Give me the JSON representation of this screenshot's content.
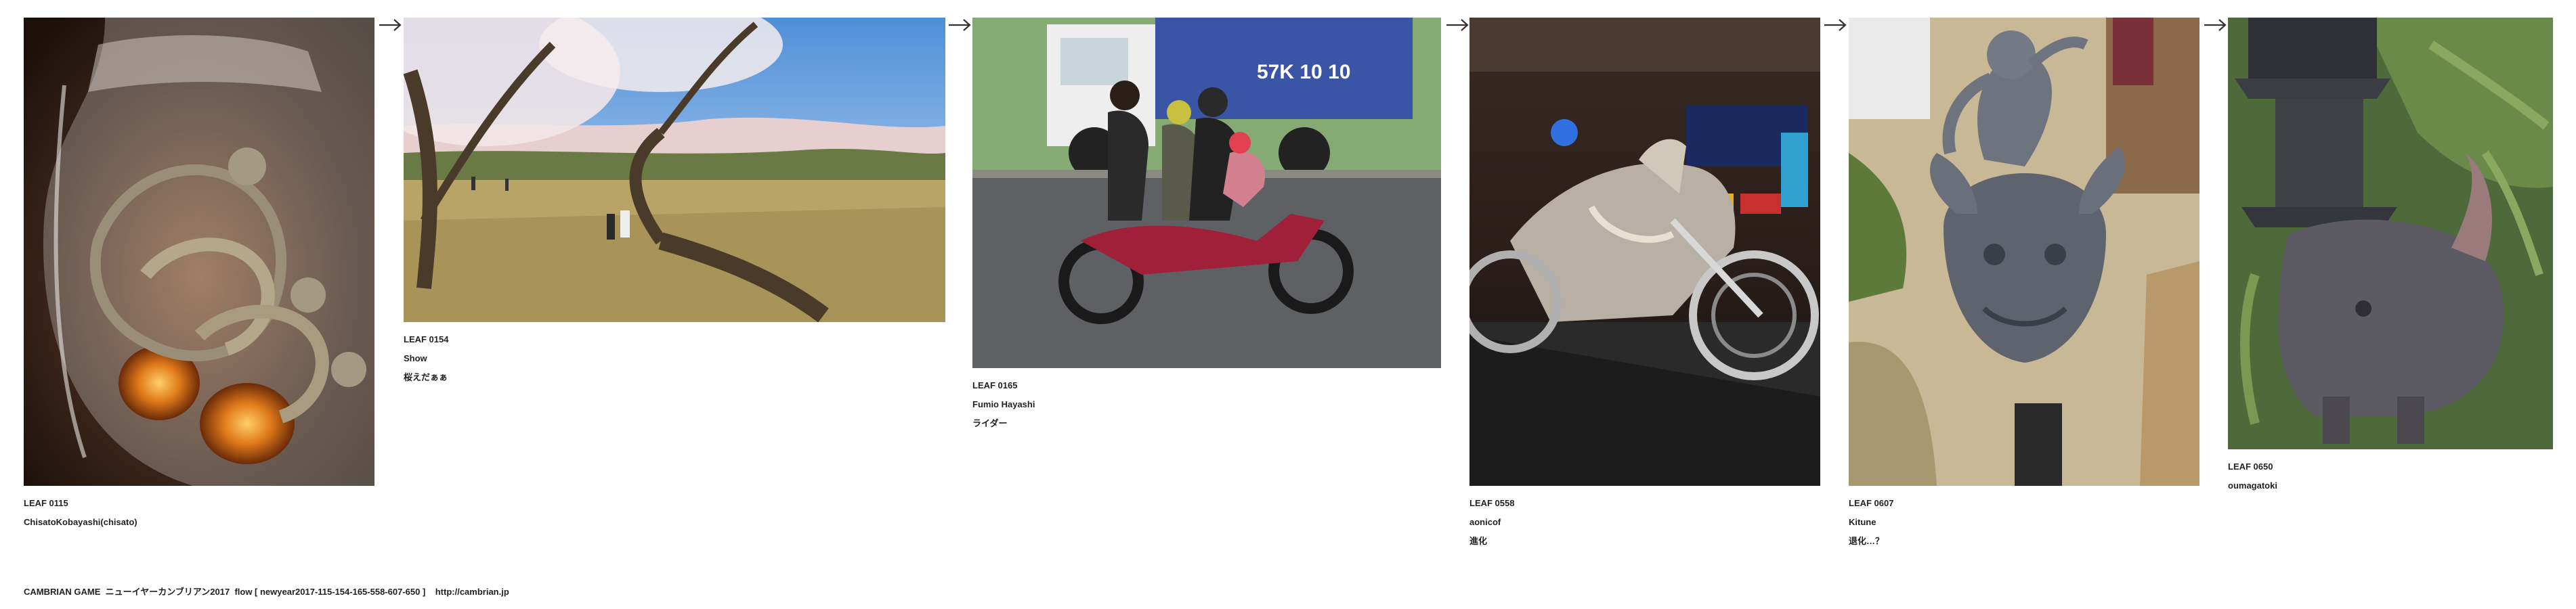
{
  "leaves": [
    {
      "id": "LEAF 0115",
      "author": "ChisatoKobayashi(chisato)",
      "title": "",
      "scene": "glass-monkeys"
    },
    {
      "id": "LEAF 0154",
      "author": "Show",
      "title": "桜えだぁぁ",
      "scene": "cherry-tree"
    },
    {
      "id": "LEAF 0165",
      "author": "Fumio Hayashi",
      "title": "ライダー",
      "scene": "motorbike-family"
    },
    {
      "id": "LEAF 0558",
      "author": "aonicof",
      "title": "進化",
      "scene": "chrome-motorcycle"
    },
    {
      "id": "LEAF 0607",
      "author": "Kitune",
      "title": "退化…？",
      "scene": "shishi-statue"
    },
    {
      "id": "LEAF 0650",
      "author": "oumagatoki",
      "title": "",
      "scene": "rhino-statue"
    }
  ],
  "arrow_icon": "right-arrow-icon",
  "footer": {
    "text": "CAMBRIAN GAME  ニューイヤーカンブリアン2017  flow [ newyear2017-115-154-165-558-607-650 ]    http://cambrian.jp"
  }
}
